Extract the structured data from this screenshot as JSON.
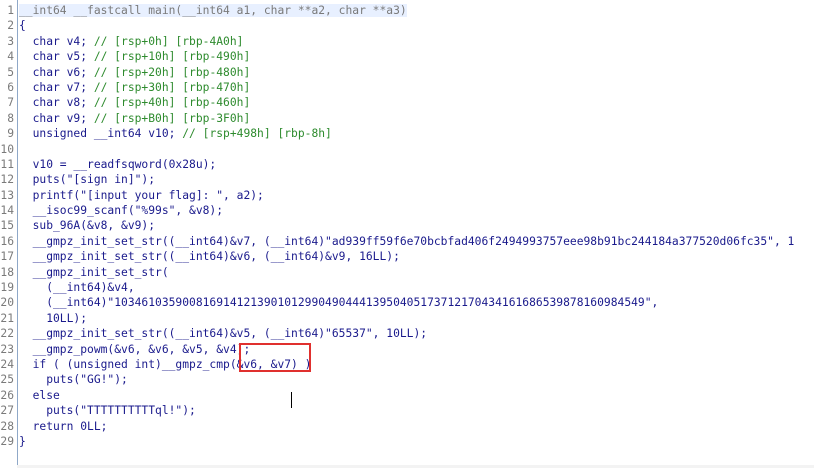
{
  "editor": {
    "colors": {
      "text": "#1a1a8c",
      "comment": "#2e8b2e",
      "gray": "#7a7a7a",
      "annotation": "#e0302e"
    },
    "lines": [
      {
        "n": "1",
        "parts": [
          [
            "g",
            "__int64 __fastcall main(__int64 a1, char **a2, char **a3)"
          ]
        ]
      },
      {
        "n": "2",
        "parts": [
          [
            "v",
            "{"
          ]
        ]
      },
      {
        "n": "3",
        "parts": [
          [
            "v",
            "  char v4; "
          ],
          [
            "c",
            "// [rsp+0h] [rbp-4A0h]"
          ]
        ]
      },
      {
        "n": "4",
        "parts": [
          [
            "v",
            "  char v5; "
          ],
          [
            "c",
            "// [rsp+10h] [rbp-490h]"
          ]
        ]
      },
      {
        "n": "5",
        "parts": [
          [
            "v",
            "  char v6; "
          ],
          [
            "c",
            "// [rsp+20h] [rbp-480h]"
          ]
        ]
      },
      {
        "n": "6",
        "parts": [
          [
            "v",
            "  char v7; "
          ],
          [
            "c",
            "// [rsp+30h] [rbp-470h]"
          ]
        ]
      },
      {
        "n": "7",
        "parts": [
          [
            "v",
            "  char v8; "
          ],
          [
            "c",
            "// [rsp+40h] [rbp-460h]"
          ]
        ]
      },
      {
        "n": "8",
        "parts": [
          [
            "v",
            "  char v9; "
          ],
          [
            "c",
            "// [rsp+B0h] [rbp-3F0h]"
          ]
        ]
      },
      {
        "n": "9",
        "parts": [
          [
            "v",
            "  unsigned __int64 v10; "
          ],
          [
            "c",
            "// [rsp+498h] [rbp-8h]"
          ]
        ]
      },
      {
        "n": "10",
        "parts": [
          [
            "v",
            ""
          ]
        ]
      },
      {
        "n": "11",
        "parts": [
          [
            "v",
            "  v10 = __readfsqword(0x28u);"
          ]
        ]
      },
      {
        "n": "12",
        "parts": [
          [
            "v",
            "  puts(\"[sign in]\");"
          ]
        ]
      },
      {
        "n": "13",
        "parts": [
          [
            "v",
            "  printf(\"[input your flag]: \", a2);"
          ]
        ]
      },
      {
        "n": "14",
        "parts": [
          [
            "v",
            "  __isoc99_scanf(\"%99s\", &v8);"
          ]
        ]
      },
      {
        "n": "15",
        "parts": [
          [
            "v",
            "  sub_96A(&v8, &v9);"
          ]
        ]
      },
      {
        "n": "16",
        "parts": [
          [
            "v",
            "  __gmpz_init_set_str((__int64)&v7, (__int64)\"ad939ff59f6e70bcbfad406f2494993757eee98b91bc244184a377520d06fc35\", 1"
          ]
        ]
      },
      {
        "n": "17",
        "parts": [
          [
            "v",
            "  __gmpz_init_set_str((__int64)&v6, (__int64)&v9, 16LL);"
          ]
        ]
      },
      {
        "n": "18",
        "parts": [
          [
            "v",
            "  __gmpz_init_set_str("
          ]
        ]
      },
      {
        "n": "19",
        "parts": [
          [
            "v",
            "    (__int64)&v4,"
          ]
        ]
      },
      {
        "n": "20",
        "parts": [
          [
            "v",
            "    (__int64)\"103461035900816914121390101299049044413950405173712170434161686539878160984549\","
          ]
        ]
      },
      {
        "n": "21",
        "parts": [
          [
            "v",
            "    10LL);"
          ]
        ]
      },
      {
        "n": "22",
        "parts": [
          [
            "v",
            "  __gmpz_init_set_str((__int64)&v5, (__int64)\"65537\", 10LL);"
          ]
        ]
      },
      {
        "n": "23",
        "parts": [
          [
            "v",
            "  __gmpz_powm(&v6, &v6, &v5, &v4);"
          ]
        ]
      },
      {
        "n": "24",
        "parts": [
          [
            "v",
            "  if ( (unsigned int)__gmpz_cmp(&v6, &v7) )"
          ]
        ]
      },
      {
        "n": "25",
        "parts": [
          [
            "v",
            "    puts(\"GG!\");"
          ]
        ]
      },
      {
        "n": "26",
        "parts": [
          [
            "v",
            "  else"
          ]
        ]
      },
      {
        "n": "27",
        "parts": [
          [
            "v",
            "    puts(\"TTTTTTTTTTql!\");"
          ]
        ]
      },
      {
        "n": "28",
        "parts": [
          [
            "v",
            "  return 0LL;"
          ]
        ]
      },
      {
        "n": "29",
        "parts": [
          [
            "v",
            "}"
          ]
        ]
      }
    ]
  }
}
